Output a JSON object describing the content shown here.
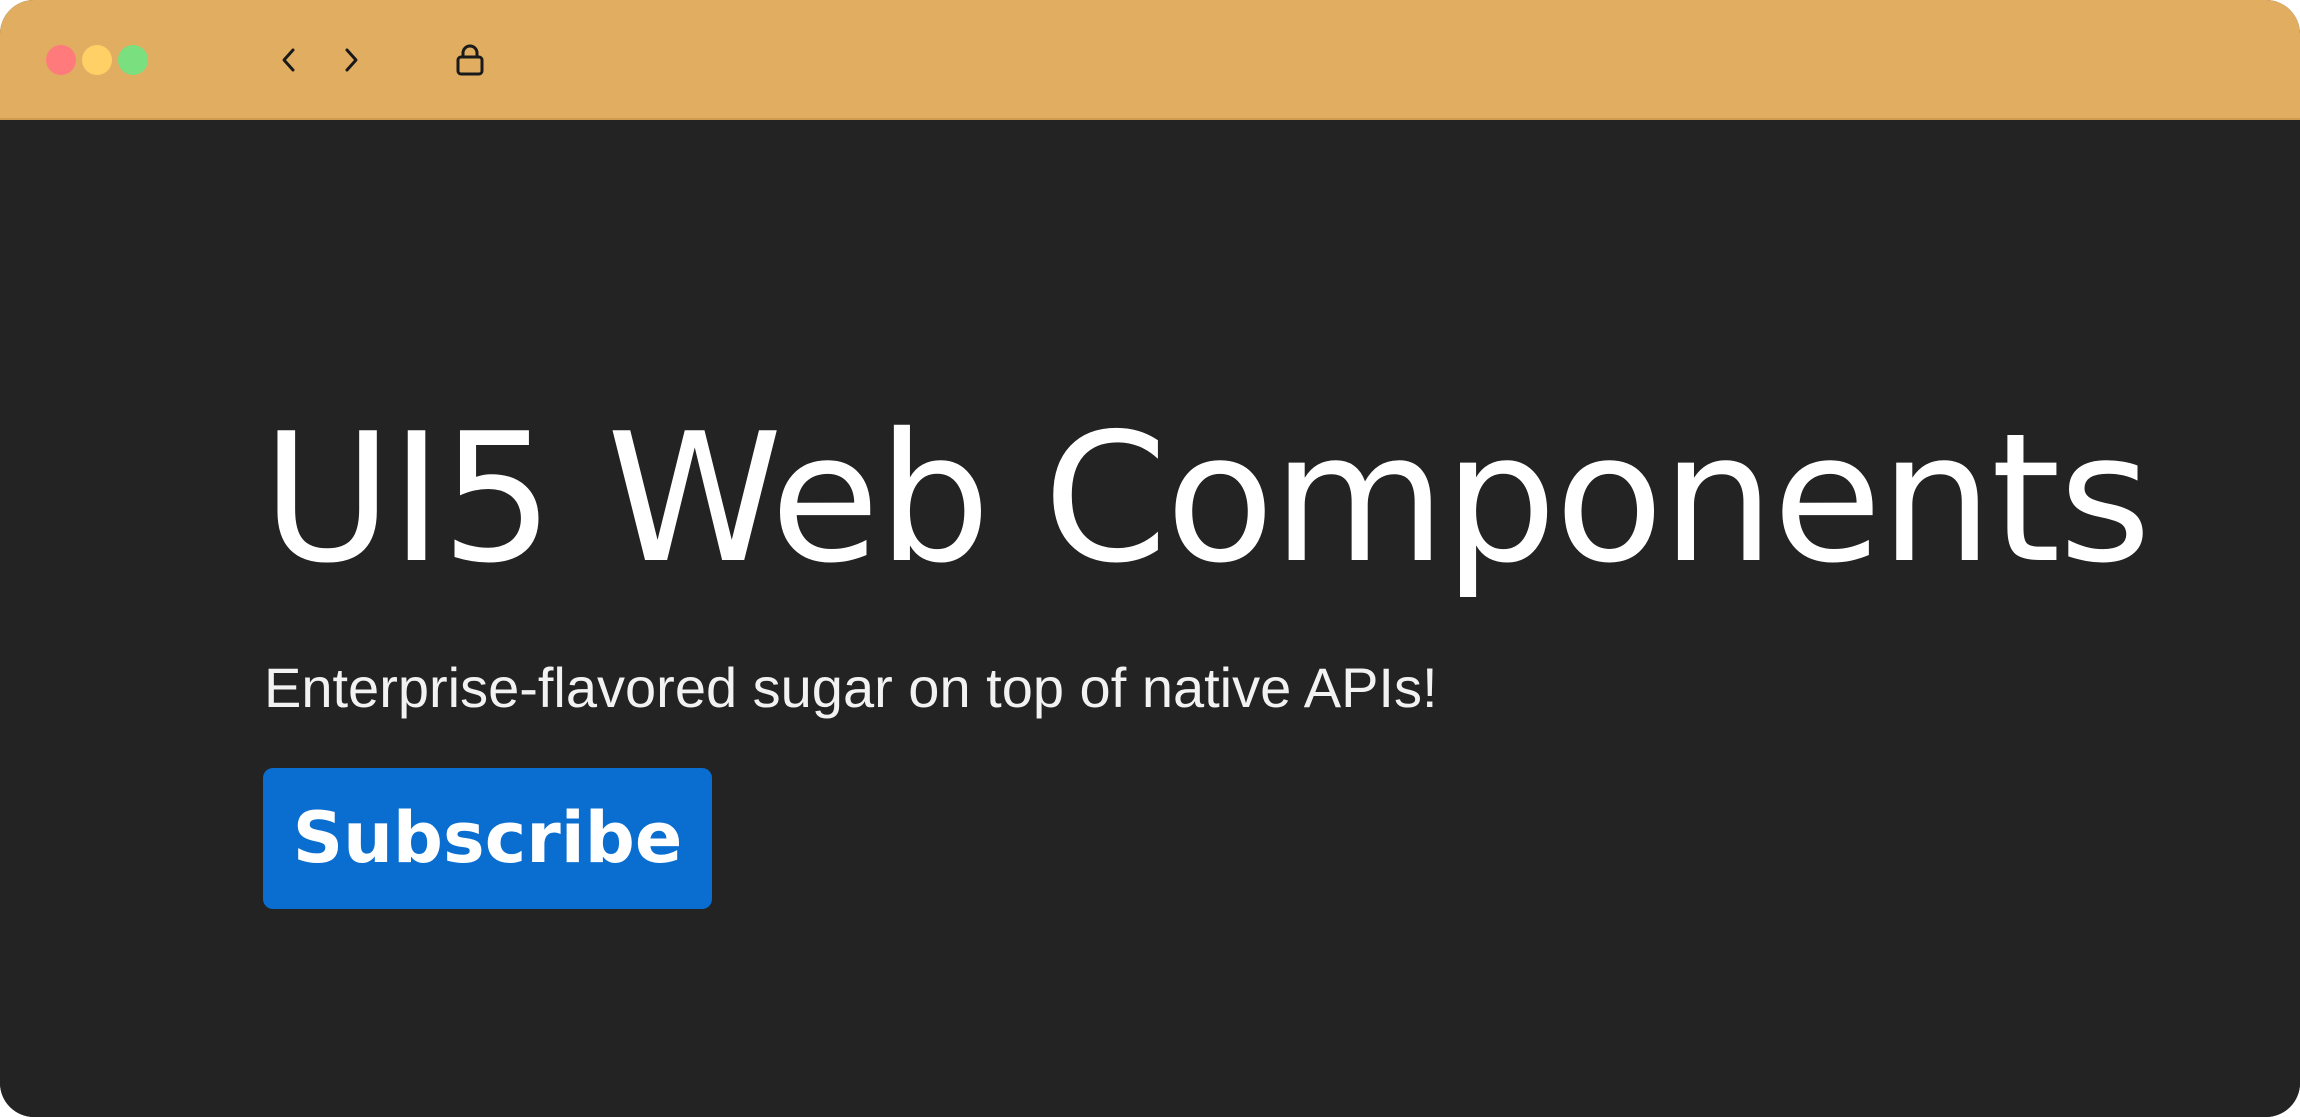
{
  "window": {
    "titlebar_color": "#e0ad61",
    "background_color": "#232323",
    "controls": {
      "close_color": "#ff7b7b",
      "minimize_color": "#ffd066",
      "maximize_color": "#7ae07f"
    },
    "toolbar": {
      "back_icon": "chevron-left-icon",
      "forward_icon": "chevron-right-icon",
      "security_icon": "lock-icon"
    }
  },
  "hero": {
    "title": "UI5 Web Components",
    "subtitle": "Enterprise-flavored sugar on top of native APIs!",
    "button_label": "Subscribe",
    "button_color": "#0a6ed1"
  }
}
